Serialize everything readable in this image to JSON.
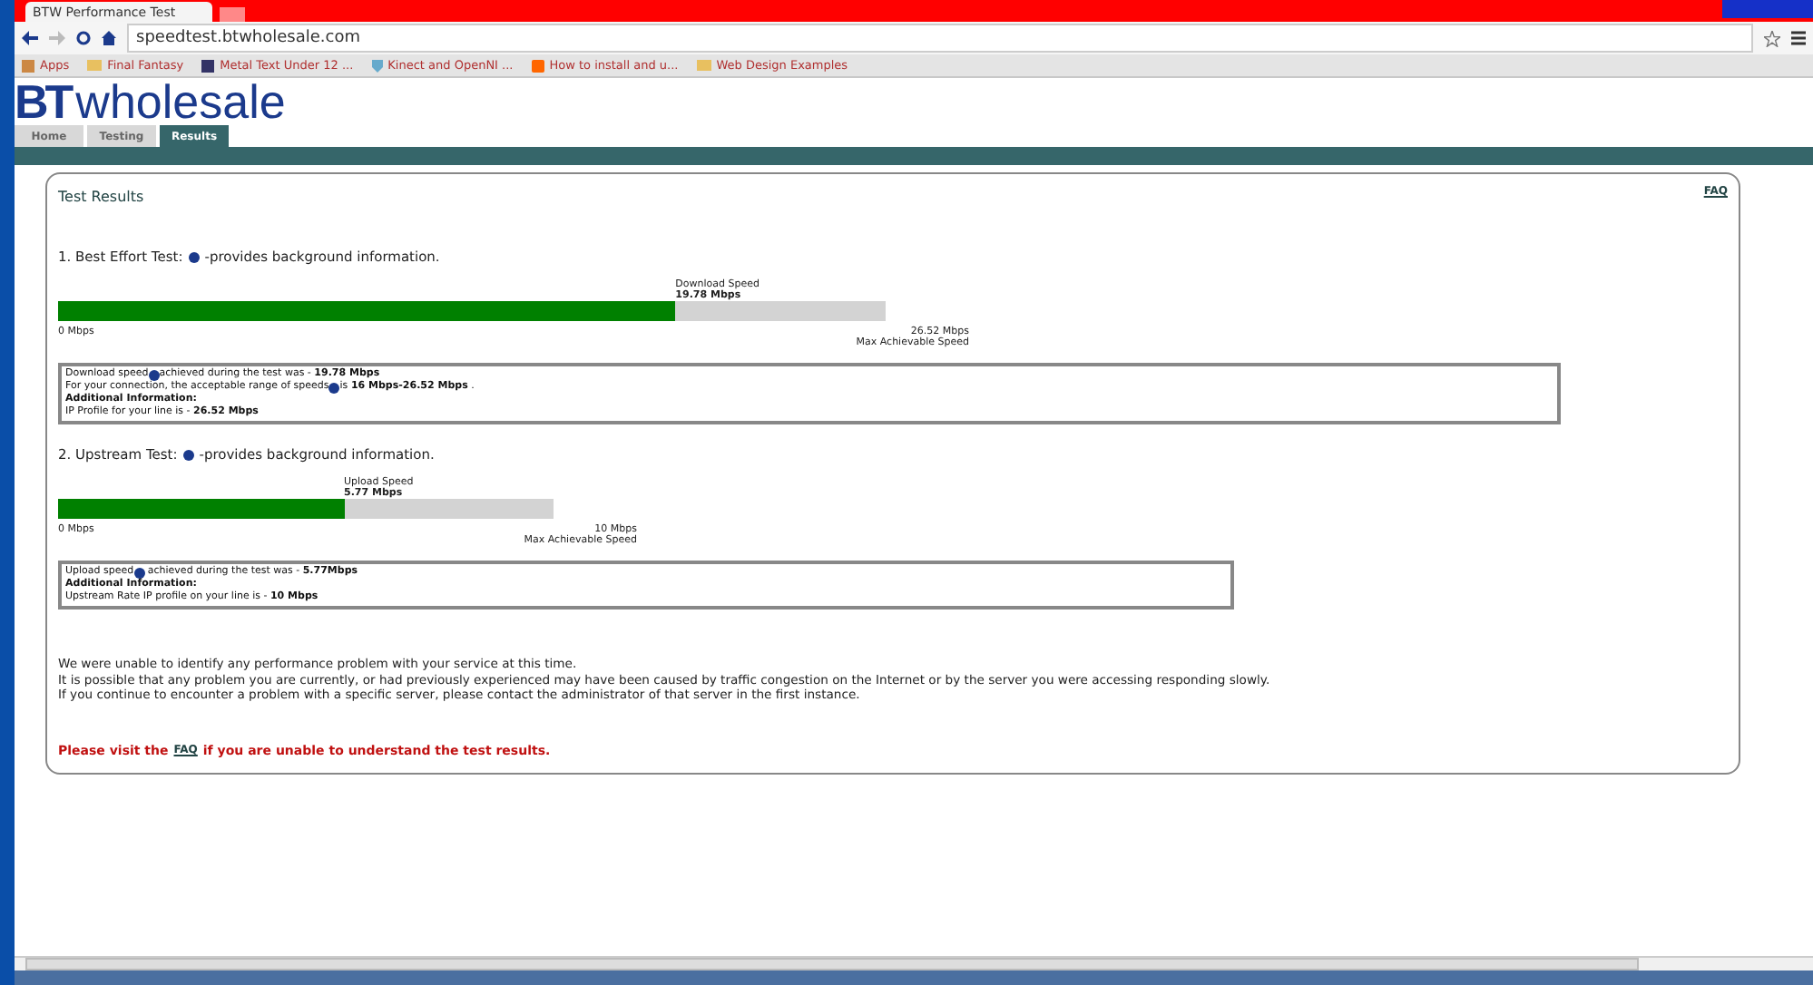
{
  "browser": {
    "tab_title": "BTW Performance Test",
    "url": "speedtest.btwholesale.com",
    "bookmarks": [
      {
        "label": "Apps",
        "kind": "apps"
      },
      {
        "label": "Final Fantasy",
        "kind": "folder"
      },
      {
        "label": "Metal Text Under 12 ...",
        "kind": "page"
      },
      {
        "label": "Kinect and OpenNI ...",
        "kind": "shield"
      },
      {
        "label": "How to install and u...",
        "kind": "blog"
      },
      {
        "label": "Web Design Examples",
        "kind": "folder"
      }
    ]
  },
  "logo": {
    "mark": "BT",
    "word": "wholesale"
  },
  "nav_tabs": [
    {
      "label": "Home",
      "selected": false
    },
    {
      "label": "Testing",
      "selected": false
    },
    {
      "label": "Results",
      "selected": true
    }
  ],
  "panel": {
    "title": "Test Results",
    "faq_link": "FAQ",
    "tests": [
      {
        "heading_before": "1. Best Effort Test:",
        "heading_after": "-provides background information.",
        "speed_label": "Download Speed",
        "speed_value": "19.78 Mbps",
        "level": 0.746,
        "min_label": "0 Mbps",
        "max_label": "26.52 Mbps",
        "max_caption": "Max Achievable Speed",
        "info_lines": [
          {
            "parts": [
              "Download speed",
              "achieved during the test was - **19.78 Mbps**"
            ]
          },
          {
            "parts": [
              "For your connection, the acceptable range of speeds",
              "is **16 Mbps-26.52 Mbps** ."
            ]
          },
          {
            "parts": [
              "**Additional Information:**"
            ]
          },
          {
            "parts": [
              "IP Profile for your line is - **26.52 Mbps**"
            ]
          }
        ]
      },
      {
        "heading_before": "2. Upstream Test:",
        "heading_after": "-provides background information.",
        "speed_label": "Upload Speed",
        "speed_value": "5.77 Mbps",
        "level": 0.577,
        "min_label": "0 Mbps",
        "max_label": "10 Mbps",
        "max_caption": "Max Achievable Speed",
        "info_lines": [
          {
            "parts": [
              "Upload speed",
              " achieved during the test was - **5.77Mbps**"
            ]
          },
          {
            "parts": [
              "**Additional Information:**"
            ]
          },
          {
            "parts": [
              "Upstream Rate IP profile on your line is - **10 Mbps**"
            ]
          }
        ]
      }
    ],
    "summary": [
      "We were unable to identify any performance problem with your service at this time.",
      "It is possible that any problem you are currently, or had previously experienced may have been caused by traffic congestion on the Internet or by the server you were accessing responding slowly.",
      "If you continue to encounter a problem with a specific server, please contact the administrator of that server in the first instance."
    ],
    "visit_before": "Please visit the",
    "visit_link": "FAQ",
    "visit_after": "if you are unable to understand the test results."
  }
}
